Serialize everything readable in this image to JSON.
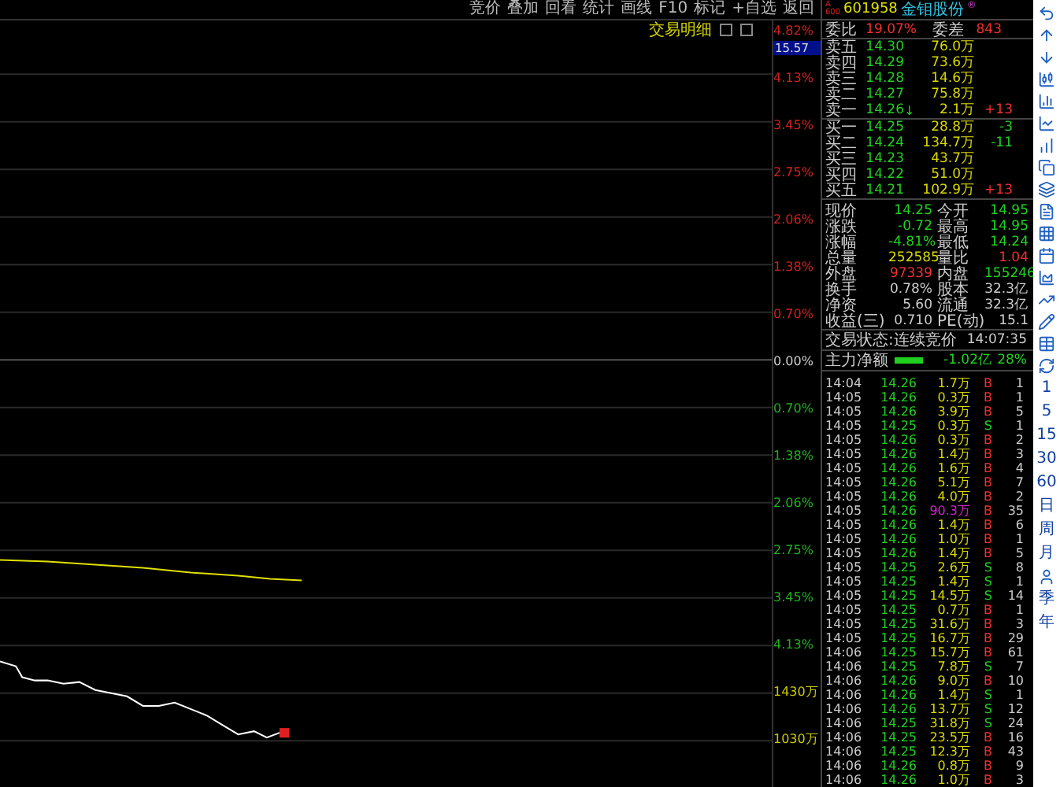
{
  "menu": [
    "竞价",
    "叠加",
    "回看",
    "统计",
    "画线",
    "F10",
    "标记",
    "+自选",
    "返回"
  ],
  "chart": {
    "title": "交易明细",
    "price_box": "15.57",
    "axis": [
      {
        "label": "4.82%",
        "color": "#d02020"
      },
      {
        "label": "4.13%",
        "color": "#d02020"
      },
      {
        "label": "3.45%",
        "color": "#d02020"
      },
      {
        "label": "2.75%",
        "color": "#d02020"
      },
      {
        "label": "2.06%",
        "color": "#d02020"
      },
      {
        "label": "1.38%",
        "color": "#d02020"
      },
      {
        "label": "0.70%",
        "color": "#d02020"
      },
      {
        "label": "0.00%",
        "color": "#cccccc"
      },
      {
        "label": "0.70%",
        "color": "#20b020"
      },
      {
        "label": "1.38%",
        "color": "#20b020"
      },
      {
        "label": "2.06%",
        "color": "#20b020"
      },
      {
        "label": "2.75%",
        "color": "#20b020"
      },
      {
        "label": "3.45%",
        "color": "#20b020"
      },
      {
        "label": "4.13%",
        "color": "#20b020"
      },
      {
        "label": "1430万",
        "color": "#c8c800"
      },
      {
        "label": "1030万",
        "color": "#c8c800"
      }
    ]
  },
  "quote": {
    "market": "A\n600",
    "code": "601958",
    "name": "金钼股份",
    "mark": "®",
    "ratio": {
      "label": "委比",
      "value": "19.07%",
      "diff_label": "委差",
      "diff": "843"
    },
    "asks": [
      {
        "label": "卖五",
        "price": "14.30",
        "volume": "76.0万"
      },
      {
        "label": "卖四",
        "price": "14.29",
        "volume": "73.6万"
      },
      {
        "label": "卖三",
        "price": "14.28",
        "volume": "14.6万"
      },
      {
        "label": "卖二",
        "price": "14.27",
        "volume": "75.8万"
      },
      {
        "label": "卖一",
        "price": "14.26",
        "flag": "↓",
        "volume": "2.1万",
        "change": {
          "text": "+13",
          "rising": true
        }
      }
    ],
    "bids": [
      {
        "label": "买一",
        "price": "14.25",
        "volume": "28.8万",
        "change": {
          "text": "-3",
          "rising": false
        }
      },
      {
        "label": "买二",
        "price": "14.24",
        "volume": "134.7万",
        "change": {
          "text": "-11",
          "rising": false
        }
      },
      {
        "label": "买三",
        "price": "14.23",
        "volume": "43.7万"
      },
      {
        "label": "买四",
        "price": "14.22",
        "volume": "51.0万"
      },
      {
        "label": "买五",
        "price": "14.21",
        "volume": "102.9万",
        "change": {
          "text": "+13",
          "rising": true
        }
      }
    ],
    "stats": [
      [
        {
          "label": "现价",
          "value": "14.25",
          "color": "#20d020"
        },
        {
          "label": "今开",
          "value": "14.95",
          "color": "#20d020"
        }
      ],
      [
        {
          "label": "涨跌",
          "value": "-0.72",
          "color": "#20d020"
        },
        {
          "label": "最高",
          "value": "14.95",
          "color": "#20d020"
        }
      ],
      [
        {
          "label": "涨幅",
          "value": "-4.81%",
          "color": "#20d020"
        },
        {
          "label": "最低",
          "value": "14.24",
          "color": "#20d020"
        }
      ],
      [
        {
          "label": "总量",
          "value": "252585",
          "color": "#d8d800"
        },
        {
          "label": "量比",
          "value": "1.04",
          "color": "#f03030"
        }
      ],
      [
        {
          "label": "外盘",
          "value": "97339",
          "color": "#f03030"
        },
        {
          "label": "内盘",
          "value": "155246",
          "color": "#20d020"
        }
      ],
      [
        {
          "label": "换手",
          "value": "0.78%",
          "color": "#cccccc"
        },
        {
          "label": "股本",
          "value": "32.3亿",
          "color": "#cccccc"
        }
      ],
      [
        {
          "label": "净资",
          "value": "5.60",
          "color": "#cccccc"
        },
        {
          "label": "流通",
          "value": "32.3亿",
          "color": "#cccccc"
        }
      ],
      [
        {
          "label": "收益(三)",
          "value": "0.710",
          "color": "#cccccc"
        },
        {
          "label": "PE(动)",
          "value": "15.1",
          "color": "#cccccc"
        }
      ]
    ],
    "status": {
      "label": "交易状态:连续竞价",
      "time": "14:07:35"
    },
    "net": {
      "label": "主力净额",
      "value": "-1.02亿",
      "share": "28%"
    }
  },
  "trades": [
    {
      "time": "14:04",
      "price": "14.26",
      "volume": "1.7万",
      "side": "B",
      "count": "1",
      "large": false
    },
    {
      "time": "14:05",
      "price": "14.26",
      "volume": "0.3万",
      "side": "B",
      "count": "1",
      "large": false
    },
    {
      "time": "14:05",
      "price": "14.26",
      "volume": "3.9万",
      "side": "B",
      "count": "5",
      "large": false
    },
    {
      "time": "14:05",
      "price": "14.25",
      "volume": "0.3万",
      "side": "S",
      "count": "1",
      "large": false
    },
    {
      "time": "14:05",
      "price": "14.26",
      "volume": "0.3万",
      "side": "B",
      "count": "2",
      "large": false
    },
    {
      "time": "14:05",
      "price": "14.26",
      "volume": "1.4万",
      "side": "B",
      "count": "3",
      "large": false
    },
    {
      "time": "14:05",
      "price": "14.26",
      "volume": "1.6万",
      "side": "B",
      "count": "4",
      "large": false
    },
    {
      "time": "14:05",
      "price": "14.26",
      "volume": "5.1万",
      "side": "B",
      "count": "7",
      "large": false
    },
    {
      "time": "14:05",
      "price": "14.26",
      "volume": "4.0万",
      "side": "B",
      "count": "2",
      "large": false
    },
    {
      "time": "14:05",
      "price": "14.26",
      "volume": "90.3万",
      "side": "B",
      "count": "35",
      "large": true
    },
    {
      "time": "14:05",
      "price": "14.26",
      "volume": "1.4万",
      "side": "B",
      "count": "6",
      "large": false
    },
    {
      "time": "14:05",
      "price": "14.26",
      "volume": "1.0万",
      "side": "B",
      "count": "1",
      "large": false
    },
    {
      "time": "14:05",
      "price": "14.26",
      "volume": "1.4万",
      "side": "B",
      "count": "5",
      "large": false
    },
    {
      "time": "14:05",
      "price": "14.25",
      "volume": "2.6万",
      "side": "S",
      "count": "8",
      "large": false
    },
    {
      "time": "14:05",
      "price": "14.25",
      "volume": "1.4万",
      "side": "S",
      "count": "1",
      "large": false
    },
    {
      "time": "14:05",
      "price": "14.25",
      "volume": "14.5万",
      "side": "S",
      "count": "14",
      "large": false
    },
    {
      "time": "14:05",
      "price": "14.25",
      "volume": "0.7万",
      "side": "B",
      "count": "1",
      "large": false
    },
    {
      "time": "14:05",
      "price": "14.25",
      "volume": "31.6万",
      "side": "B",
      "count": "3",
      "large": false
    },
    {
      "time": "14:05",
      "price": "14.25",
      "volume": "16.7万",
      "side": "B",
      "count": "29",
      "large": false
    },
    {
      "time": "14:06",
      "price": "14.25",
      "volume": "15.7万",
      "side": "B",
      "count": "61",
      "large": false
    },
    {
      "time": "14:06",
      "price": "14.25",
      "volume": "7.8万",
      "side": "S",
      "count": "7",
      "large": false
    },
    {
      "time": "14:06",
      "price": "14.26",
      "volume": "9.0万",
      "side": "B",
      "count": "10",
      "large": false
    },
    {
      "time": "14:06",
      "price": "14.26",
      "volume": "1.4万",
      "side": "S",
      "count": "1",
      "large": false
    },
    {
      "time": "14:06",
      "price": "14.26",
      "volume": "13.7万",
      "side": "S",
      "count": "12",
      "large": false
    },
    {
      "time": "14:06",
      "price": "14.25",
      "volume": "31.8万",
      "side": "S",
      "count": "24",
      "large": false
    },
    {
      "time": "14:06",
      "price": "14.25",
      "volume": "23.5万",
      "side": "B",
      "count": "16",
      "large": false
    },
    {
      "time": "14:06",
      "price": "14.25",
      "volume": "12.3万",
      "side": "B",
      "count": "43",
      "large": false
    },
    {
      "time": "14:06",
      "price": "14.26",
      "volume": "0.8万",
      "side": "B",
      "count": "9",
      "large": false
    },
    {
      "time": "14:06",
      "price": "14.26",
      "volume": "1.0万",
      "side": "B",
      "count": "3",
      "large": false
    }
  ],
  "toolbar": {
    "periods": [
      "1",
      "5",
      "15",
      "30",
      "60",
      "日",
      "周",
      "月"
    ],
    "more": [
      "季",
      "年"
    ]
  }
}
